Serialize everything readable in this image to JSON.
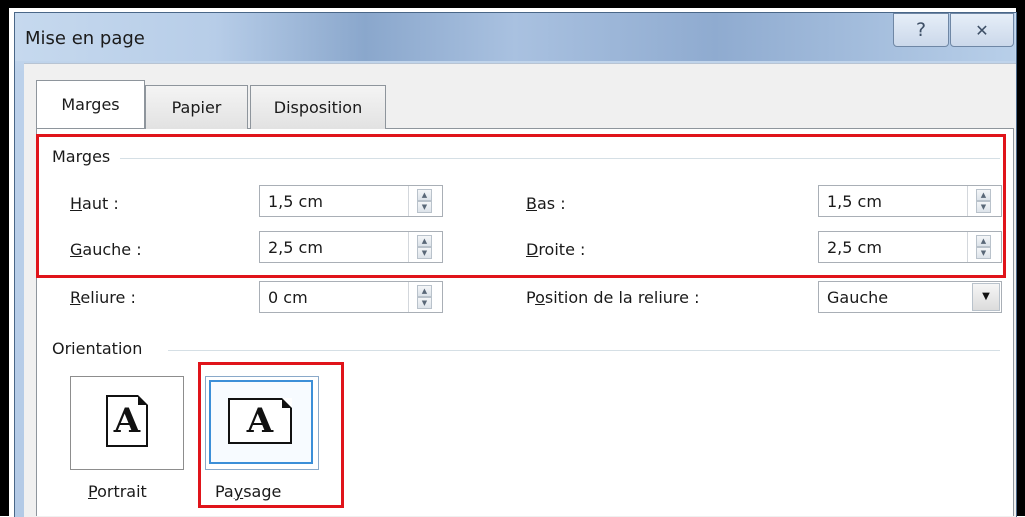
{
  "window": {
    "title": "Mise en page",
    "help_icon": "?",
    "close_icon": "✕"
  },
  "tabs": [
    {
      "label": "Marges",
      "active": true
    },
    {
      "label": "Papier",
      "active": false
    },
    {
      "label": "Disposition",
      "active": false
    }
  ],
  "margins_group": {
    "label": "Marges",
    "top": {
      "mnemonic": "H",
      "rest": "aut :",
      "value": "1,5 cm"
    },
    "bottom": {
      "mnemonic": "B",
      "rest": "as :",
      "value": "1,5 cm"
    },
    "left": {
      "mnemonic": "G",
      "rest": "auche :",
      "value": "2,5 cm"
    },
    "right": {
      "mnemonic": "D",
      "rest": "roite :",
      "value": "2,5 cm"
    },
    "gutter": {
      "mnemonic": "R",
      "rest": "eliure :",
      "value": "0 cm"
    },
    "gutter_position": {
      "pre": "P",
      "mnemonic": "o",
      "rest": "sition de la reliure :",
      "value": "Gauche"
    }
  },
  "orientation_group": {
    "label": "Orientation",
    "portrait": {
      "mnemonic": "P",
      "rest": "ortrait",
      "glyph": "A",
      "selected": false
    },
    "paysage": {
      "pre": "Pa",
      "mnemonic": "y",
      "rest": "sage",
      "glyph": "A",
      "selected": true
    }
  },
  "colors": {
    "highlight_red": "#e0141a",
    "selection_blue": "#3c8fd8"
  }
}
